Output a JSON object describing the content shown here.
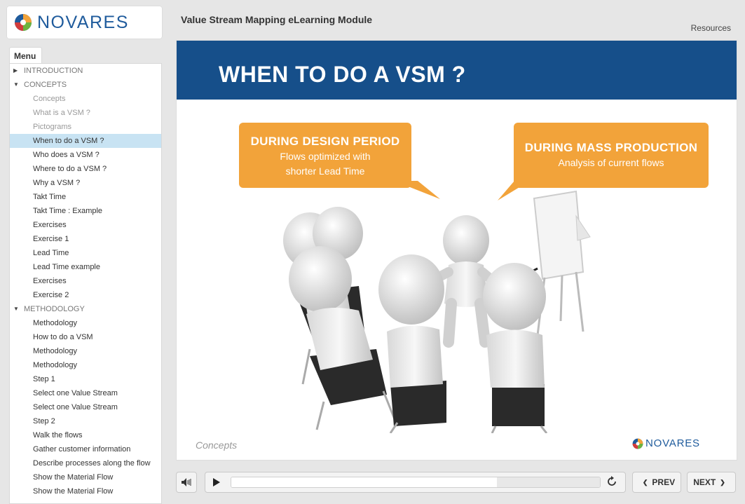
{
  "brand": {
    "logo_text": "NOVARES"
  },
  "header": {
    "title": "Value Stream Mapping eLearning Module",
    "resources": "Resources"
  },
  "menu": {
    "tab_label": "Menu",
    "items": [
      {
        "label": "INTRODUCTION",
        "type": "section",
        "expanded": false
      },
      {
        "label": "CONCEPTS",
        "type": "section",
        "expanded": true
      },
      {
        "label": "Concepts",
        "type": "child",
        "state": "visited"
      },
      {
        "label": "What is a VSM ?",
        "type": "child",
        "state": "visited"
      },
      {
        "label": "Pictograms",
        "type": "child",
        "state": "visited"
      },
      {
        "label": "When to do a VSM ?",
        "type": "child",
        "state": "active"
      },
      {
        "label": "Who does a VSM ?",
        "type": "child",
        "state": "normal"
      },
      {
        "label": "Where to do a VSM ?",
        "type": "child",
        "state": "normal"
      },
      {
        "label": "Why a VSM ?",
        "type": "child",
        "state": "normal"
      },
      {
        "label": "Takt Time",
        "type": "child",
        "state": "normal"
      },
      {
        "label": "Takt Time : Example",
        "type": "child",
        "state": "normal"
      },
      {
        "label": "Exercises",
        "type": "child",
        "state": "normal"
      },
      {
        "label": "Exercise 1",
        "type": "child",
        "state": "normal"
      },
      {
        "label": "Lead Time",
        "type": "child",
        "state": "normal"
      },
      {
        "label": "Lead Time example",
        "type": "child",
        "state": "normal"
      },
      {
        "label": "Exercises",
        "type": "child",
        "state": "normal"
      },
      {
        "label": "Exercise 2",
        "type": "child",
        "state": "normal"
      },
      {
        "label": "METHODOLOGY",
        "type": "section",
        "expanded": true
      },
      {
        "label": "Methodology",
        "type": "child",
        "state": "normal"
      },
      {
        "label": "How to do a VSM",
        "type": "child",
        "state": "normal"
      },
      {
        "label": "Methodology",
        "type": "child",
        "state": "normal"
      },
      {
        "label": "Methodology",
        "type": "child",
        "state": "normal"
      },
      {
        "label": "Step 1",
        "type": "child",
        "state": "normal"
      },
      {
        "label": "Select one Value Stream",
        "type": "child",
        "state": "normal"
      },
      {
        "label": "Select one Value Stream",
        "type": "child",
        "state": "normal"
      },
      {
        "label": "Step 2",
        "type": "child",
        "state": "normal"
      },
      {
        "label": "Walk the flows",
        "type": "child",
        "state": "normal"
      },
      {
        "label": "Gather customer information",
        "type": "child",
        "state": "normal"
      },
      {
        "label": "Describe processes along the flow",
        "type": "child",
        "state": "normal"
      },
      {
        "label": "Show the Material Flow",
        "type": "child",
        "state": "normal"
      },
      {
        "label": "Show the Material Flow",
        "type": "child",
        "state": "normal"
      }
    ]
  },
  "slide": {
    "title": "WHEN TO DO A VSM ?",
    "bubble_left": {
      "heading": "DURING DESIGN PERIOD",
      "line1": "Flows optimized with",
      "line2": "shorter Lead Time"
    },
    "bubble_right": {
      "heading": "DURING MASS PRODUCTION",
      "line1": "Analysis of current flows"
    },
    "footer_section": "Concepts",
    "footer_logo": "NOVARES"
  },
  "player": {
    "prev_label": "PREV",
    "next_label": "NEXT",
    "progress_fraction": 0.72
  },
  "colors": {
    "banner": "#164f8a",
    "bubble": "#f2a33a",
    "active_row": "#c8e3f3",
    "brand_blue": "#1f5b9c"
  }
}
